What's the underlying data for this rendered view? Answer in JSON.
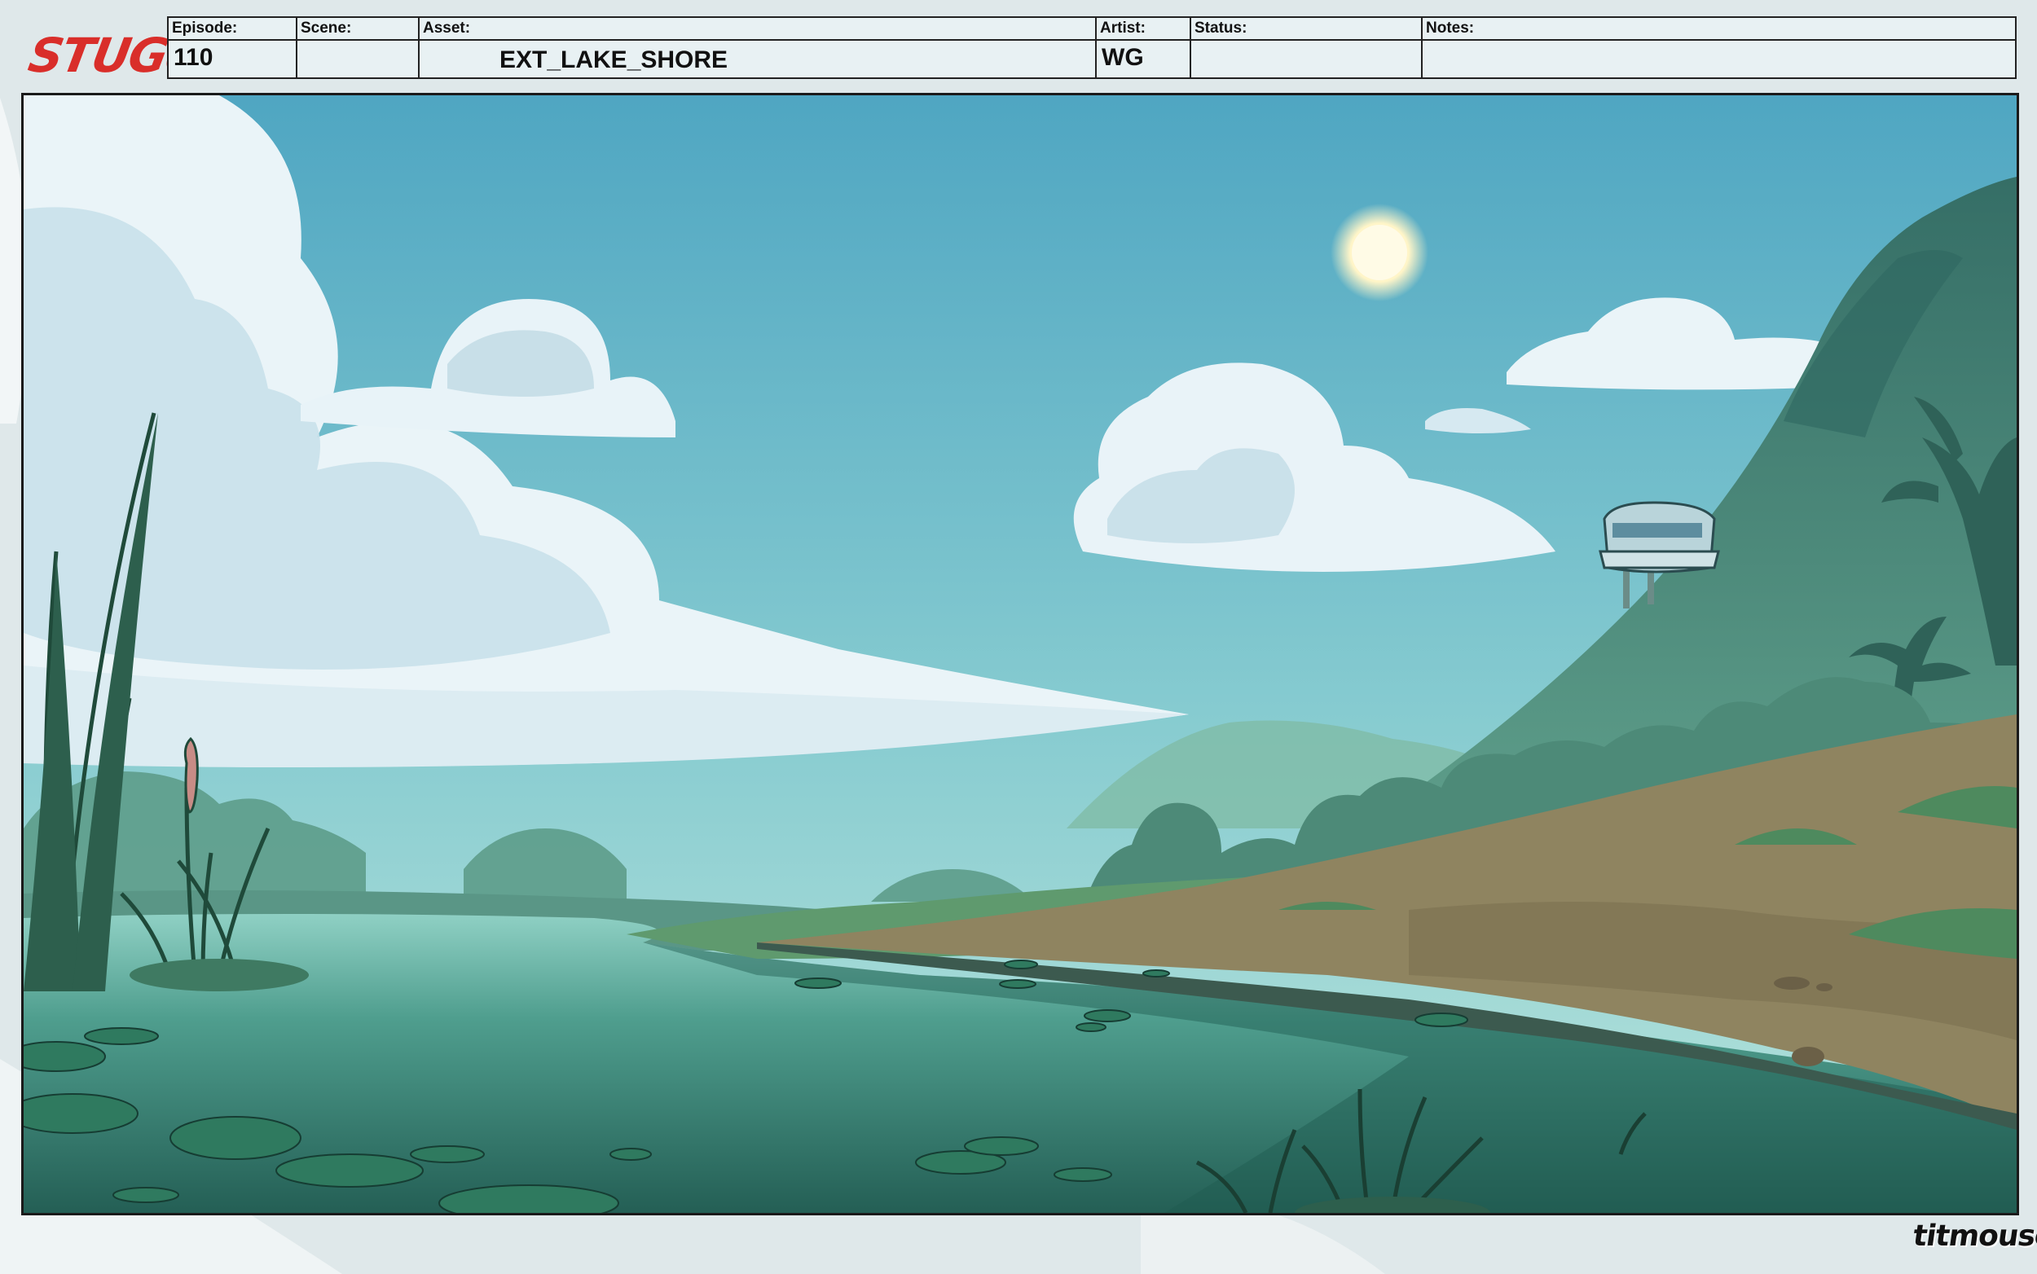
{
  "logo": {
    "text": "STUGo",
    "color": "#d92e2a"
  },
  "slate": {
    "episode": {
      "label": "Episode:",
      "value": "110"
    },
    "scene": {
      "label": "Scene:",
      "value": ""
    },
    "asset": {
      "label": "Asset:",
      "value": "EXT_LAKE_SHORE"
    },
    "artist": {
      "label": "Artist:",
      "value": "WG"
    },
    "status": {
      "label": "Status:",
      "value": ""
    },
    "notes": {
      "label": "Notes:",
      "value": ""
    }
  },
  "studio_logo": {
    "text": "titmouse"
  },
  "colors": {
    "sky_top": "#4fa6c2",
    "sky_bottom": "#a9dcd6",
    "cloud": "#eef6fa",
    "water": "#2f7f73",
    "shore": "#8f8460",
    "foliage": "#3f7a6a",
    "mountain": "#3b7269"
  }
}
